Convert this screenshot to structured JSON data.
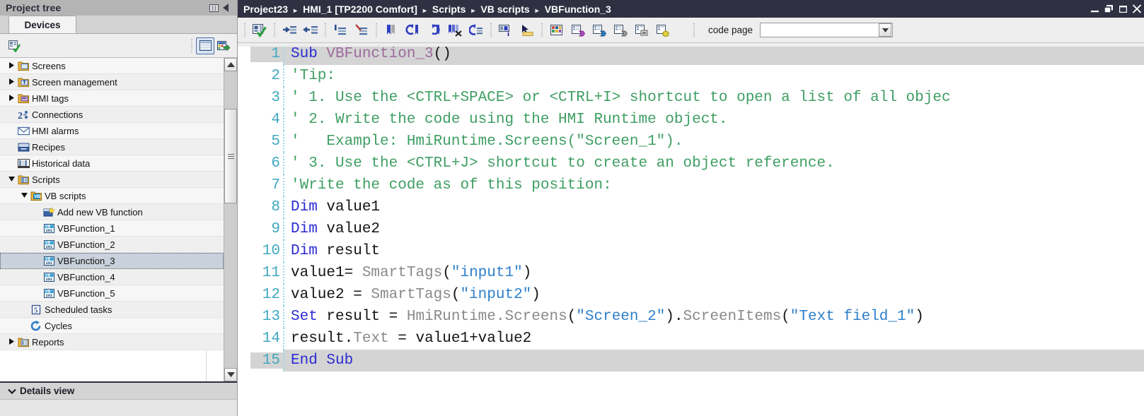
{
  "left_panel": {
    "title": "Project tree",
    "title_icons": [
      "columns-icon",
      "collapse-left-icon"
    ],
    "tabs": [
      {
        "label": "Devices"
      }
    ],
    "toolbar": {
      "icons": [
        "device-overview-icon",
        "show-all-columns-icon",
        "export-icon"
      ]
    },
    "tree": [
      {
        "label": "Screens",
        "icon": "screens-folder-icon",
        "arrow": "collapsed",
        "indent": 1
      },
      {
        "label": "Screen management",
        "icon": "screen-management-icon",
        "arrow": "collapsed",
        "indent": 1
      },
      {
        "label": "HMI tags",
        "icon": "hmi-tags-folder-icon",
        "arrow": "collapsed",
        "indent": 1
      },
      {
        "label": "Connections",
        "icon": "connections-icon",
        "arrow": "none",
        "indent": 1
      },
      {
        "label": "HMI alarms",
        "icon": "hmi-alarms-icon",
        "arrow": "none",
        "indent": 1
      },
      {
        "label": "Recipes",
        "icon": "recipes-icon",
        "arrow": "none",
        "indent": 1
      },
      {
        "label": "Historical data",
        "icon": "historical-data-icon",
        "arrow": "none",
        "indent": 1
      },
      {
        "label": "Scripts",
        "icon": "scripts-folder-icon",
        "arrow": "expanded",
        "indent": 1
      },
      {
        "label": "VB scripts",
        "icon": "vb-scripts-folder-icon",
        "arrow": "expanded",
        "indent": 2
      },
      {
        "label": "Add new VB function",
        "icon": "add-new-vb-function-icon",
        "arrow": "none",
        "indent": 3
      },
      {
        "label": "VBFunction_1",
        "icon": "vb-function-icon",
        "arrow": "none",
        "indent": 3
      },
      {
        "label": "VBFunction_2",
        "icon": "vb-function-icon",
        "arrow": "none",
        "indent": 3
      },
      {
        "label": "VBFunction_3",
        "icon": "vb-function-icon",
        "arrow": "none",
        "indent": 3,
        "selected": true
      },
      {
        "label": "VBFunction_4",
        "icon": "vb-function-icon",
        "arrow": "none",
        "indent": 3
      },
      {
        "label": "VBFunction_5",
        "icon": "vb-function-icon",
        "arrow": "none",
        "indent": 3
      },
      {
        "label": "Scheduled tasks",
        "icon": "scheduled-tasks-icon",
        "arrow": "none",
        "indent": 2
      },
      {
        "label": "Cycles",
        "icon": "cycles-icon",
        "arrow": "none",
        "indent": 2
      },
      {
        "label": "Reports",
        "icon": "reports-folder-icon",
        "arrow": "collapsed",
        "indent": 1
      }
    ],
    "details_view": {
      "label": "Details view",
      "chevron": "chevron-down-icon"
    }
  },
  "editor": {
    "breadcrumb": [
      "Project23",
      "HMI_1 [TP2200 Comfort]",
      "Scripts",
      "VB scripts",
      "VBFunction_3"
    ],
    "breadcrumb_separator": "▸",
    "window_buttons": [
      "minimize-button",
      "restore-button",
      "maximize-button",
      "close-button"
    ],
    "toolbar_icons": [
      "check-syntax-icon",
      "indent-icon",
      "outdent-icon",
      "bookmark-first-icon",
      "bookmark-clear-icon",
      "toggle-bookmark-icon",
      "previous-bookmark-icon",
      "next-bookmark-icon",
      "delete-all-bookmarks-icon",
      "goto-bookmark-icon",
      "object-info-icon",
      "object-reference-icon",
      "insert-snippet-icon",
      "insert-tag-icon",
      "insert-screen-object-icon",
      "insert-function-icon",
      "insert-list-icon",
      "insert-constant-icon"
    ],
    "code_page": {
      "label": "code page",
      "value": "",
      "dropdown_icon": "chevron-down-icon"
    },
    "code_lines": [
      {
        "n": 1,
        "highlight": true,
        "tokens": [
          {
            "t": "Sub",
            "c": "k"
          },
          {
            "t": " ",
            "c": "pl"
          },
          {
            "t": "VBFunction_3",
            "c": "fn"
          },
          {
            "t": "()",
            "c": "pn"
          }
        ]
      },
      {
        "n": 2,
        "tokens": [
          {
            "t": "'Tip:",
            "c": "cm"
          }
        ]
      },
      {
        "n": 3,
        "tokens": [
          {
            "t": "' 1. Use the <CTRL+SPACE> or <CTRL+I> shortcut to open a list of all objec",
            "c": "cm"
          }
        ]
      },
      {
        "n": 4,
        "tokens": [
          {
            "t": "' 2. Write the code using the HMI Runtime object.",
            "c": "cm"
          }
        ]
      },
      {
        "n": 5,
        "tokens": [
          {
            "t": "'   Example: HmiRuntime.Screens(\"Screen_1\").",
            "c": "cm"
          }
        ]
      },
      {
        "n": 6,
        "tokens": [
          {
            "t": "' 3. Use the <CTRL+J> shortcut to create an object reference.",
            "c": "cm"
          }
        ]
      },
      {
        "n": 7,
        "tokens": [
          {
            "t": "'Write the code as of this position:",
            "c": "cm"
          }
        ]
      },
      {
        "n": 8,
        "tokens": [
          {
            "t": "Dim",
            "c": "k"
          },
          {
            "t": " value1",
            "c": "pl"
          }
        ]
      },
      {
        "n": 9,
        "tokens": [
          {
            "t": "Dim",
            "c": "k"
          },
          {
            "t": " value2",
            "c": "pl"
          }
        ]
      },
      {
        "n": 10,
        "tokens": [
          {
            "t": "Dim",
            "c": "k"
          },
          {
            "t": " result",
            "c": "pl"
          }
        ]
      },
      {
        "n": 11,
        "tokens": [
          {
            "t": "value1= ",
            "c": "pl"
          },
          {
            "t": "SmartTags",
            "c": "ob"
          },
          {
            "t": "(",
            "c": "pn"
          },
          {
            "t": "\"input1\"",
            "c": "st"
          },
          {
            "t": ")",
            "c": "pn"
          }
        ]
      },
      {
        "n": 12,
        "tokens": [
          {
            "t": "value2 = ",
            "c": "pl"
          },
          {
            "t": "SmartTags",
            "c": "ob"
          },
          {
            "t": "(",
            "c": "pn"
          },
          {
            "t": "\"input2\"",
            "c": "st"
          },
          {
            "t": ")",
            "c": "pn"
          }
        ]
      },
      {
        "n": 13,
        "tokens": [
          {
            "t": "Set",
            "c": "k"
          },
          {
            "t": " result = ",
            "c": "pl"
          },
          {
            "t": "HmiRuntime.Screens",
            "c": "ob"
          },
          {
            "t": "(",
            "c": "pn"
          },
          {
            "t": "\"Screen_2\"",
            "c": "st"
          },
          {
            "t": ")",
            "c": "pn"
          },
          {
            "t": ".",
            "c": "pn"
          },
          {
            "t": "ScreenItems",
            "c": "ob"
          },
          {
            "t": "(",
            "c": "pn"
          },
          {
            "t": "\"Text field_1\"",
            "c": "st"
          },
          {
            "t": ")",
            "c": "pn"
          }
        ]
      },
      {
        "n": 14,
        "tokens": [
          {
            "t": "result",
            "c": "pl"
          },
          {
            "t": ".",
            "c": "pn"
          },
          {
            "t": "Text",
            "c": "ob"
          },
          {
            "t": " = value1+value2",
            "c": "pl"
          }
        ]
      },
      {
        "n": 15,
        "highlight": true,
        "tokens": [
          {
            "t": "End Sub",
            "c": "k"
          }
        ]
      }
    ]
  },
  "colors": {
    "titlebar": "#2f3142",
    "panel_header": "#b4b4b4",
    "selection": "#c9d2dc",
    "line_highlight": "#d4d4d4",
    "keyword": "#2b2bd4",
    "comment": "#3f9e63",
    "string": "#2f7fc9",
    "object": "#8a8a8a",
    "function_name": "#9c6b9c",
    "line_number": "#3fa8c0"
  }
}
